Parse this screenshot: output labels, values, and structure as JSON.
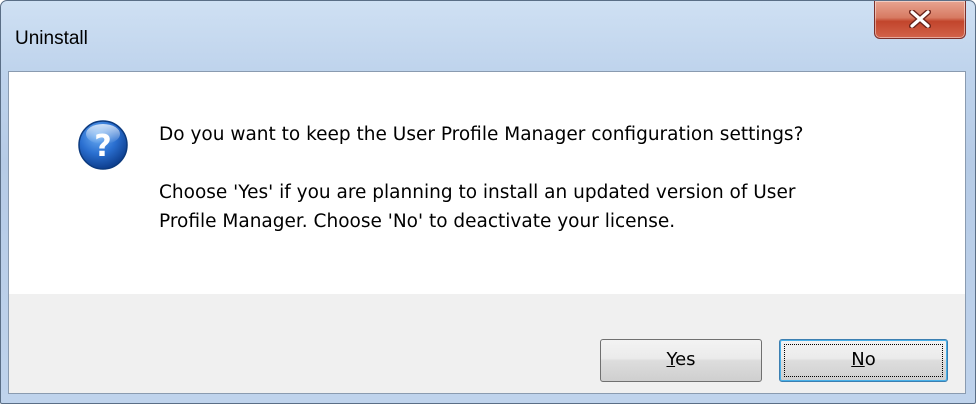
{
  "window": {
    "title": "Uninstall"
  },
  "titlebar": {
    "close_icon": "close-icon"
  },
  "dialog": {
    "icon": "question-icon",
    "question": "Do you want to keep the User Profile Manager configuration settings?",
    "detail_line1": "Choose 'Yes' if you are planning to install an updated version of User",
    "detail_line2": "Profile Manager. Choose 'No' to deactivate your license."
  },
  "buttons": {
    "yes_mnemonic": "Y",
    "yes_rest": "es",
    "no_mnemonic": "N",
    "no_rest": "o"
  },
  "colors": {
    "close_button": "#c2452c",
    "question_icon": "#1a5bb8",
    "footer": "#f0f0f0"
  }
}
